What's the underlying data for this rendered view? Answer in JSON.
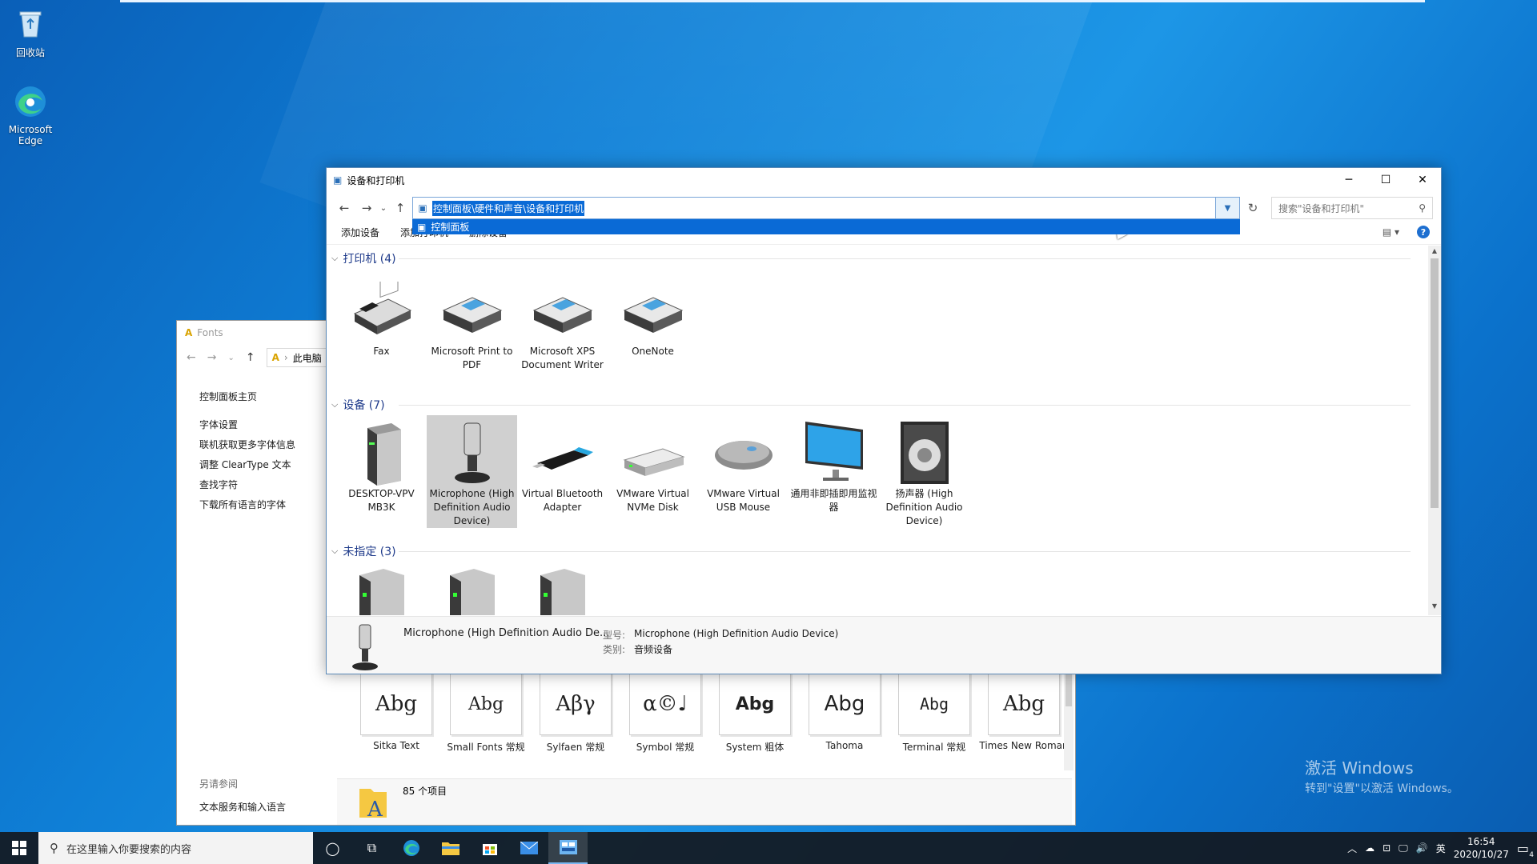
{
  "desktop": {
    "icons": [
      {
        "label": "回收站",
        "icon": "recycle-bin-icon"
      },
      {
        "label": "Microsoft Edge",
        "icon": "edge-icon"
      }
    ]
  },
  "fonts_window": {
    "title": "Fonts",
    "crumb": "此电脑",
    "side_head": "控制面板主页",
    "side_links": [
      "字体设置",
      "联机获取更多字体信息",
      "调整 ClearType 文本",
      "查找字符",
      "下载所有语言的字体"
    ],
    "see_also": "另请参阅",
    "see_also_link": "文本服务和输入语言",
    "fonts": [
      {
        "sample": "Abg",
        "name": "Sitka Text"
      },
      {
        "sample": "Abg",
        "name": "Small Fonts 常规"
      },
      {
        "sample": "Αβγ",
        "name": "Sylfaen 常规"
      },
      {
        "sample": "α©♩",
        "name": "Symbol 常规"
      },
      {
        "sample": "Abg",
        "name": "System 粗体"
      },
      {
        "sample": "Abg",
        "name": "Tahoma"
      },
      {
        "sample": "Abg",
        "name": "Terminal 常规"
      },
      {
        "sample": "Abg",
        "name": "Times New Roman"
      }
    ],
    "status": "85 个项目"
  },
  "main_window": {
    "title": "设备和打印机",
    "address": "控制面板\\硬件和声音\\设备和打印机",
    "dropdown_item": "控制面板",
    "search_placeholder": "搜索\"设备和打印机\"",
    "toolbar": [
      "添加设备",
      "添加打印机",
      "删除设备"
    ],
    "groups": [
      {
        "title": "打印机 (4)",
        "items": [
          {
            "label": "Fax",
            "icon": "fax-icon"
          },
          {
            "label": "Microsoft Print to PDF",
            "icon": "printer-icon"
          },
          {
            "label": "Microsoft XPS Document Writer",
            "icon": "printer-icon"
          },
          {
            "label": "OneNote",
            "icon": "printer-icon"
          }
        ]
      },
      {
        "title": "设备 (7)",
        "items": [
          {
            "label": "DESKTOP-VPV MB3K",
            "icon": "computer-tower-icon"
          },
          {
            "label": "Microphone (High Definition Audio Device)",
            "icon": "microphone-icon",
            "selected": true
          },
          {
            "label": "Virtual Bluetooth Adapter",
            "icon": "usb-bluetooth-icon"
          },
          {
            "label": "VMware Virtual NVMe Disk",
            "icon": "disk-drive-icon"
          },
          {
            "label": "VMware Virtual USB Mouse",
            "icon": "mouse-icon"
          },
          {
            "label": "通用非即插即用监视器",
            "icon": "monitor-icon"
          },
          {
            "label": "扬声器 (High Definition Audio Device)",
            "icon": "speaker-icon"
          }
        ]
      },
      {
        "title": "未指定 (3)",
        "items": [
          {
            "label": "",
            "icon": "computer-tower-icon"
          },
          {
            "label": "",
            "icon": "computer-tower-icon"
          },
          {
            "label": "",
            "icon": "computer-tower-icon"
          }
        ]
      }
    ],
    "details": {
      "name": "Microphone (High Definition Audio De...",
      "model_key": "型号:",
      "model_val": "Microphone (High Definition Audio Device)",
      "category_key": "类别:",
      "category_val": "音频设备"
    }
  },
  "activate": {
    "line1": "激活 Windows",
    "line2": "转到\"设置\"以激活 Windows。"
  },
  "taskbar": {
    "search_placeholder": "在这里输入你要搜索的内容",
    "ime": "英",
    "time": "16:54",
    "date": "2020/10/27",
    "notif_count": "4"
  }
}
